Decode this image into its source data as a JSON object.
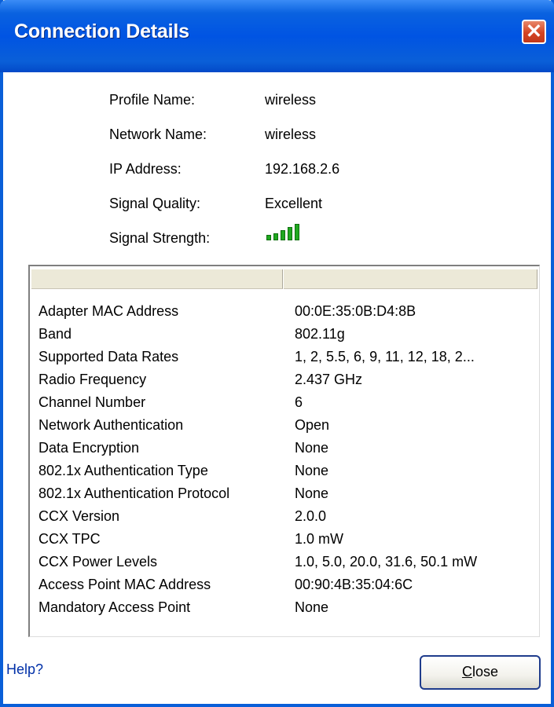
{
  "window": {
    "title": "Connection Details",
    "close_glyph": "✕"
  },
  "summary": [
    {
      "label": "Profile Name:",
      "value": "wireless"
    },
    {
      "label": "Network Name:",
      "value": "wireless"
    },
    {
      "label": "IP Address:",
      "value": "192.168.2.6"
    },
    {
      "label": "Signal Quality:",
      "value": "Excellent"
    },
    {
      "label": "Signal Strength:",
      "value": ""
    }
  ],
  "signal_strength": {
    "bars_filled": 5,
    "bars_total": 5,
    "icon": "signal-strength-icon",
    "color": "#1fa81f"
  },
  "details": {
    "headers": [
      "",
      ""
    ],
    "rows": [
      {
        "key": "Adapter MAC Address",
        "value": "00:0E:35:0B:D4:8B"
      },
      {
        "key": "Band",
        "value": "802.11g"
      },
      {
        "key": "Supported Data Rates",
        "value": "1, 2, 5.5, 6, 9, 11, 12, 18, 2..."
      },
      {
        "key": "Radio Frequency",
        "value": "2.437 GHz"
      },
      {
        "key": "Channel Number",
        "value": "6"
      },
      {
        "key": "Network Authentication",
        "value": "Open"
      },
      {
        "key": "Data Encryption",
        "value": "None"
      },
      {
        "key": "802.1x Authentication Type",
        "value": "None"
      },
      {
        "key": "802.1x Authentication Protocol",
        "value": "None"
      },
      {
        "key": "CCX Version",
        "value": "2.0.0"
      },
      {
        "key": "CCX TPC",
        "value": "1.0 mW"
      },
      {
        "key": "CCX Power Levels",
        "value": "1.0, 5.0, 20.0, 31.6, 50.1 mW"
      },
      {
        "key": "Access Point MAC Address",
        "value": "00:90:4B:35:04:6C"
      },
      {
        "key": "Mandatory Access Point",
        "value": "None"
      }
    ]
  },
  "footer": {
    "help_label": "Help?",
    "close_accel": "C",
    "close_rest": "lose"
  }
}
